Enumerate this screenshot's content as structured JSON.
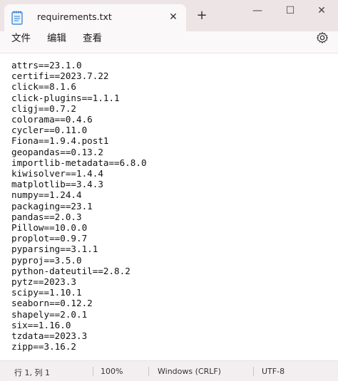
{
  "tab": {
    "title": "requirements.txt",
    "close_glyph": "✕"
  },
  "titlebar": {
    "new_tab_glyph": "+",
    "minimize_glyph": "—",
    "maximize_glyph": "☐",
    "close_glyph": "✕"
  },
  "menu": {
    "items": [
      {
        "label": "文件"
      },
      {
        "label": "编辑"
      },
      {
        "label": "查看"
      }
    ]
  },
  "editor": {
    "lines": [
      "attrs==23.1.0",
      "certifi==2023.7.22",
      "click==8.1.6",
      "click-plugins==1.1.1",
      "cligj==0.7.2",
      "colorama==0.4.6",
      "cycler==0.11.0",
      "Fiona==1.9.4.post1",
      "geopandas==0.13.2",
      "importlib-metadata==6.8.0",
      "kiwisolver==1.4.4",
      "matplotlib==3.4.3",
      "numpy==1.24.4",
      "packaging==23.1",
      "pandas==2.0.3",
      "Pillow==10.0.0",
      "proplot==0.9.7",
      "pyparsing==3.1.1",
      "pyproj==3.5.0",
      "python-dateutil==2.8.2",
      "pytz==2023.3",
      "scipy==1.10.1",
      "seaborn==0.12.2",
      "shapely==2.0.1",
      "six==1.16.0",
      "tzdata==2023.3",
      "zipp==3.16.2"
    ]
  },
  "status": {
    "position": "行 1, 列 1",
    "zoom": "100%",
    "line_ending": "Windows (CRLF)",
    "encoding": "UTF-8"
  },
  "colors": {
    "titlebar_bg": "#ede4e6",
    "tab_bg": "#fbf8f9",
    "icon_blue": "#2b7bd3"
  }
}
